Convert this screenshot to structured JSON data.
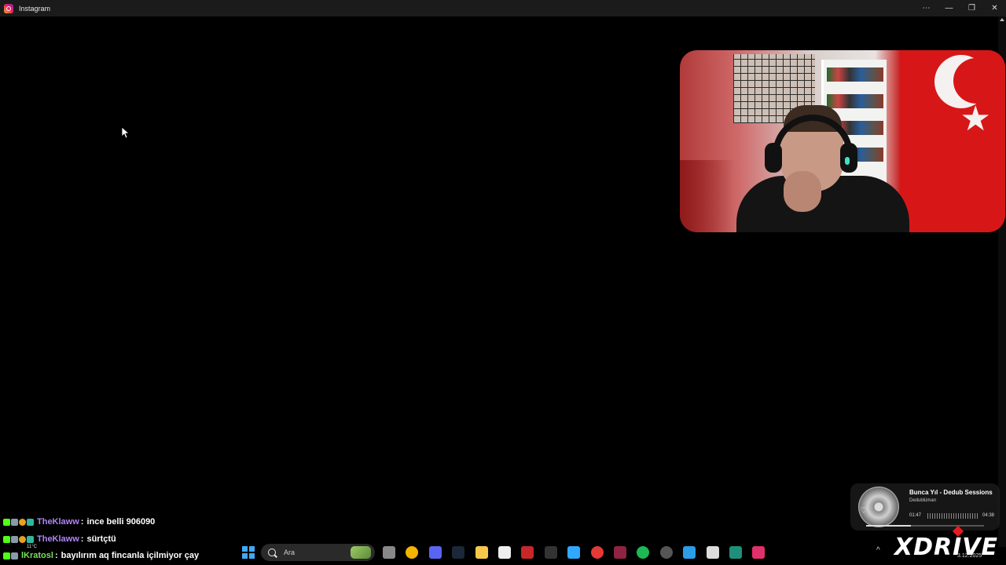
{
  "window": {
    "title": "Instagram",
    "controls": {
      "more": "⋯",
      "minimize": "—",
      "restore": "❐",
      "close": "✕"
    }
  },
  "chat": [
    {
      "user": "TheKlaww",
      "message": "ince belli 906090",
      "name_color": "#b085f5"
    },
    {
      "user": "TheKlaww",
      "message": "sürtçtü",
      "name_color": "#b085f5"
    },
    {
      "user": "lKratosl",
      "message": "bayılırım aq fincanla içilmiyor çay",
      "name_color": "#7be05c"
    }
  ],
  "music": {
    "title": "Bunca Yıl - Dedub Sessions",
    "artist": "Dedublüman",
    "current_time": "01:47",
    "duration": "04:38",
    "progress": 0.38
  },
  "taskbar": {
    "search_placeholder": "Ara",
    "weather": "11°C",
    "date": "3.12.2025",
    "apps": [
      "task-view-icon",
      "chrome-icon",
      "discord-icon",
      "steam-icon",
      "file-explorer-icon",
      "capcut-icon",
      "voice-mod-icon",
      "epic-games-icon",
      "photoshop-icon",
      "red-app-icon",
      "media-app-icon",
      "spotify-icon",
      "obs-icon",
      "photos-icon",
      "logitech-icon",
      "terminal-app-icon",
      "instagram-icon"
    ]
  },
  "overlay": {
    "brand": "DRIVE"
  },
  "colors": {
    "titlebar": "#1b1b1b",
    "flag_red": "#d71717",
    "kick_green": "#53fc18",
    "win_blue": "#3fa9f5"
  }
}
